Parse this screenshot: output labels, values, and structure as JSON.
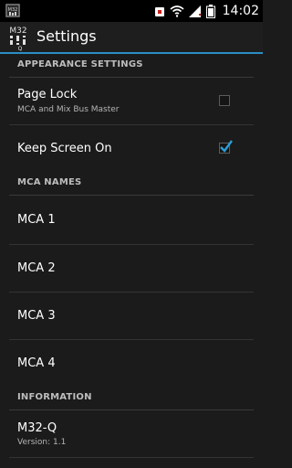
{
  "status_bar": {
    "time": "14:02",
    "icons": [
      "android-debug-icon",
      "alert-icon",
      "wifi-icon",
      "signal-icon",
      "battery-icon"
    ]
  },
  "action_bar": {
    "logo_text": "M32",
    "logo_sub": "Q",
    "title": "Settings"
  },
  "sections": {
    "appearance": {
      "header": "APPEARANCE SETTINGS",
      "page_lock": {
        "title": "Page Lock",
        "summary": "MCA and Mix Bus Master",
        "checked": false
      },
      "keep_screen_on": {
        "title": "Keep Screen On",
        "checked": true
      }
    },
    "mca_names": {
      "header": "MCA NAMES",
      "items": [
        {
          "label": "MCA 1"
        },
        {
          "label": "MCA 2"
        },
        {
          "label": "MCA 3"
        },
        {
          "label": "MCA 4"
        }
      ]
    },
    "information": {
      "header": "INFORMATION",
      "app_name": "M32-Q",
      "version": "Version: 1.1"
    }
  },
  "colors": {
    "accent": "#2b8fc4",
    "background": "#1b1b1b",
    "status_bar": "#000000"
  }
}
